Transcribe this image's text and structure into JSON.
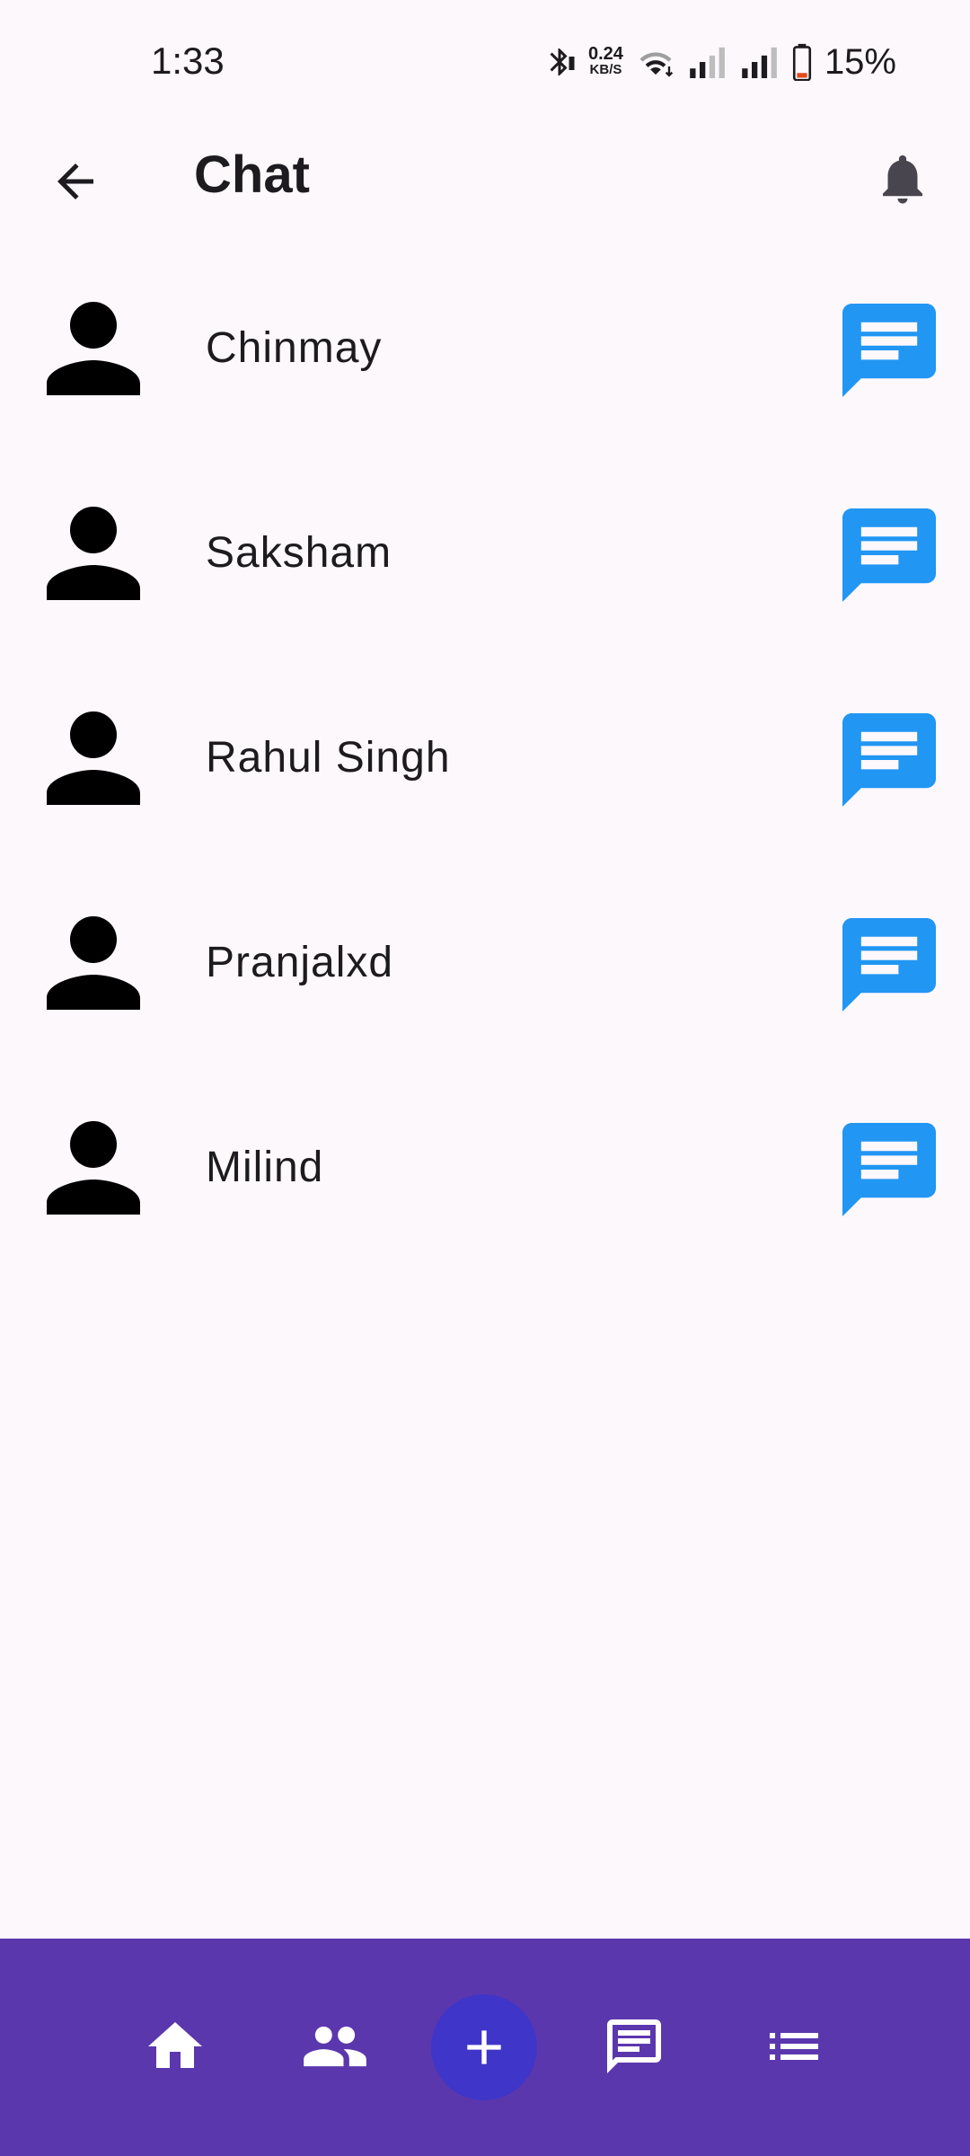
{
  "status_bar": {
    "time": "1:33",
    "net_speed_value": "0.24",
    "net_speed_unit": "KB/S",
    "battery_percent": "15%"
  },
  "app_bar": {
    "title": "Chat",
    "back_icon": "arrow-back-icon",
    "notification_icon": "bell-icon"
  },
  "contacts": [
    {
      "name": "Chinmay"
    },
    {
      "name": "Saksham"
    },
    {
      "name": "Rahul Singh"
    },
    {
      "name": "Pranjalxd"
    },
    {
      "name": "Milind"
    }
  ],
  "bottom_nav": {
    "items": [
      "home-icon",
      "people-icon",
      "add-icon",
      "chat-icon",
      "list-icon"
    ]
  },
  "colors": {
    "background": "#fdf8fc",
    "accent_blue": "#2196f3",
    "nav_purple": "#5b37ad",
    "fab_indigo": "#3f35c9"
  }
}
